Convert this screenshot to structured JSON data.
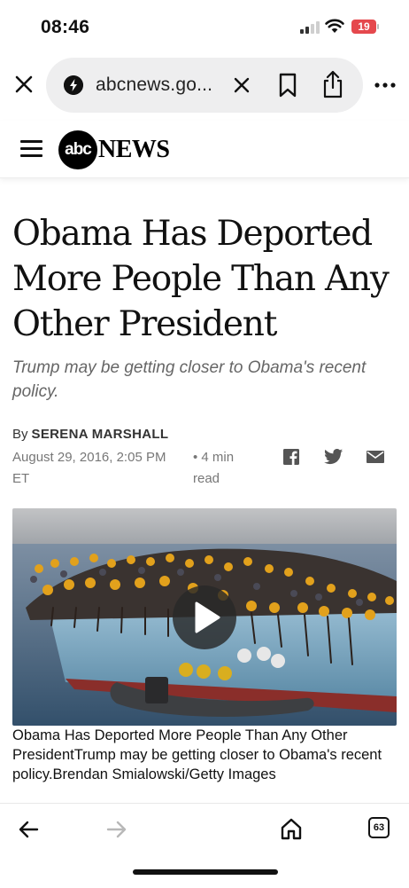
{
  "status_bar": {
    "time": "08:46",
    "battery": "19",
    "battery_color": "#e5484d"
  },
  "browser": {
    "url": "abcnews.go...",
    "icons": [
      "close-icon",
      "site-icon",
      "clear-icon",
      "bookmark-icon",
      "share-icon",
      "more-icon"
    ]
  },
  "site": {
    "logo_abc": "abc",
    "logo_news": "NEWS"
  },
  "article": {
    "headline": "Obama Has Deported More People Than Any Other President",
    "subhead": "Trump may be getting closer to Obama's recent policy.",
    "by_label": "By",
    "author": "SERENA MARSHALL",
    "date": "August 29, 2016, 2:05 PM ET",
    "read_time": "• 4 min read",
    "social_icons": [
      "facebook-icon",
      "twitter-icon",
      "mail-icon"
    ],
    "caption": "Obama Has Deported More People Than Any Other PresidentTrump may be getting closer to Obama's recent policy.Brendan Smialowski/Getty Images"
  },
  "toolbar": {
    "tab_count": "63",
    "icons": [
      "back-arrow-icon",
      "forward-arrow-icon",
      "home-icon",
      "tabs-icon"
    ]
  }
}
